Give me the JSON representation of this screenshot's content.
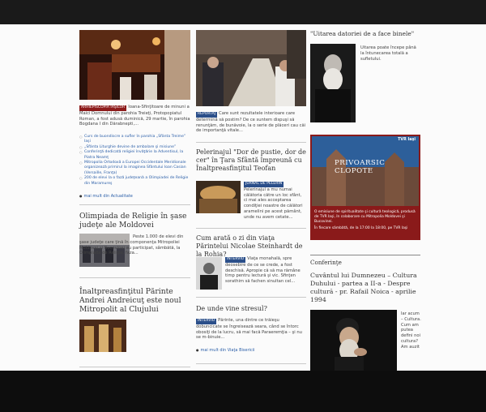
{
  "col1": {
    "tag1": "ARHIEPISCOPIA IAŞILOR",
    "intro": "Ioana-Sfinţitoare de minuni a Maici Domnului din parohia Treieţi, Protopopiatul Roman, a fost adusă duminică, 29 martie, în parohia Bogdana I din Dărabnepti,...",
    "links": [
      "Curs de buondiscre a sufler în parohia „Sfânta Treime” Iaşi",
      "„Sfânta Liturghie devine de ambalare şi misiune”",
      "Conferinţă dedicată religiei învăţărie la Adventisul, la Piatra Neamţ",
      "Mitropolia Ortodoxă a Europei Occidentale Meridionale organizează primirul la imaginea Sfântului Ioan Casian (Versaille, Franţa)",
      "200 de elevi la o fază judeţeană a Olimpiadei de Religie din Maramureş"
    ],
    "more": "mai mult din Actualitate",
    "headline2": "Olimpiada de Religie în şase judeţe ale Moldovei",
    "text2": "Peste 1.000 de elevi din şase judeţe care ţină în componenţa Mitropoliei Moldovei şi Bucovinei au participat, sâmbătă, la Olimpiada de Religie, faza...",
    "headline3": "Înaltpreasfinţitul Părinte Andrei Andreicuţ este noul Mitropolit al Clujului"
  },
  "col2": {
    "tag1": "REPORTAJ",
    "text1": "Care sunt rezultatele interioare care determină să postim? De ce suntem dispuşi să renunţăm, de bunăvoie, la o serie de plăceri cau căi de importanţă vitale...",
    "headline2": "Pelerinajul \"Dor de pustie, dor de cer\" în Ţara Sfântă împreună cu Înaltpreasfinţitul Teofan",
    "tag2": "JURNAL DE PELERIN",
    "text2": "Pelerinajul a mu numai călătoria către un loc sfânt, ci mai ales acceptarea condiţiei noastre de călători aramelini pe acest pământ, unde nu avem cetate...",
    "headline3": "Cum arată o zi din viaţa Părintelui Nicolae Steinhardt de la Rohia?",
    "tag3": "INTERVIU",
    "text3": "Viaţa monahală, spre deosebire de ce se crede, a fost deschisă. Apropie că să ma rămâne timp pentru lectură şi vic. Sfinţen sorathim să fachen sinultan cel...",
    "headline4": "De unde vine stresul?",
    "tag4": "INTERVIU",
    "text4": "Părinte, una dintre ce trăieşu dobuncicate se îngreisează seara, când se întorc obosiţi de la lucru, să mai facă Paraeremţia – şi nu se m-binuie...",
    "more": "mai mult din Viaţa Bisericii"
  },
  "col3": {
    "headline1": "\"Uitarea datoriei de a face binele\"",
    "text1": "Uitarea poate începe până la întunecarea totală a sufletului.",
    "banner_label": "TVR Iaşi",
    "banner_title": "PRIVOARSIC CLOPOTE",
    "banner_text": "O emisiune de spiritualitate şi cultură teologică, produsă de TVR Iaşi, în colaborare cu Mitropolia Moldovei şi Bucovinei.",
    "banner_schedule": "În fiecare sâmbătă, de la 17:00 la 18:00, pe TVR Iaşi",
    "section": "Conferinţe",
    "headline2": "Cuvântul lui Dumnezeu – Cultura Duhului - partea a II-a - Despre cultură - pr. Rafail Noica - aprilie 1994",
    "side_text": "Iar acum – Cultura. Cum am putea defini noi cultura? Am auzit"
  },
  "colors": {
    "tag_red": "#8d1c1c",
    "link_blue": "#2a5ea8",
    "banner_red": "#8a1a1a"
  }
}
